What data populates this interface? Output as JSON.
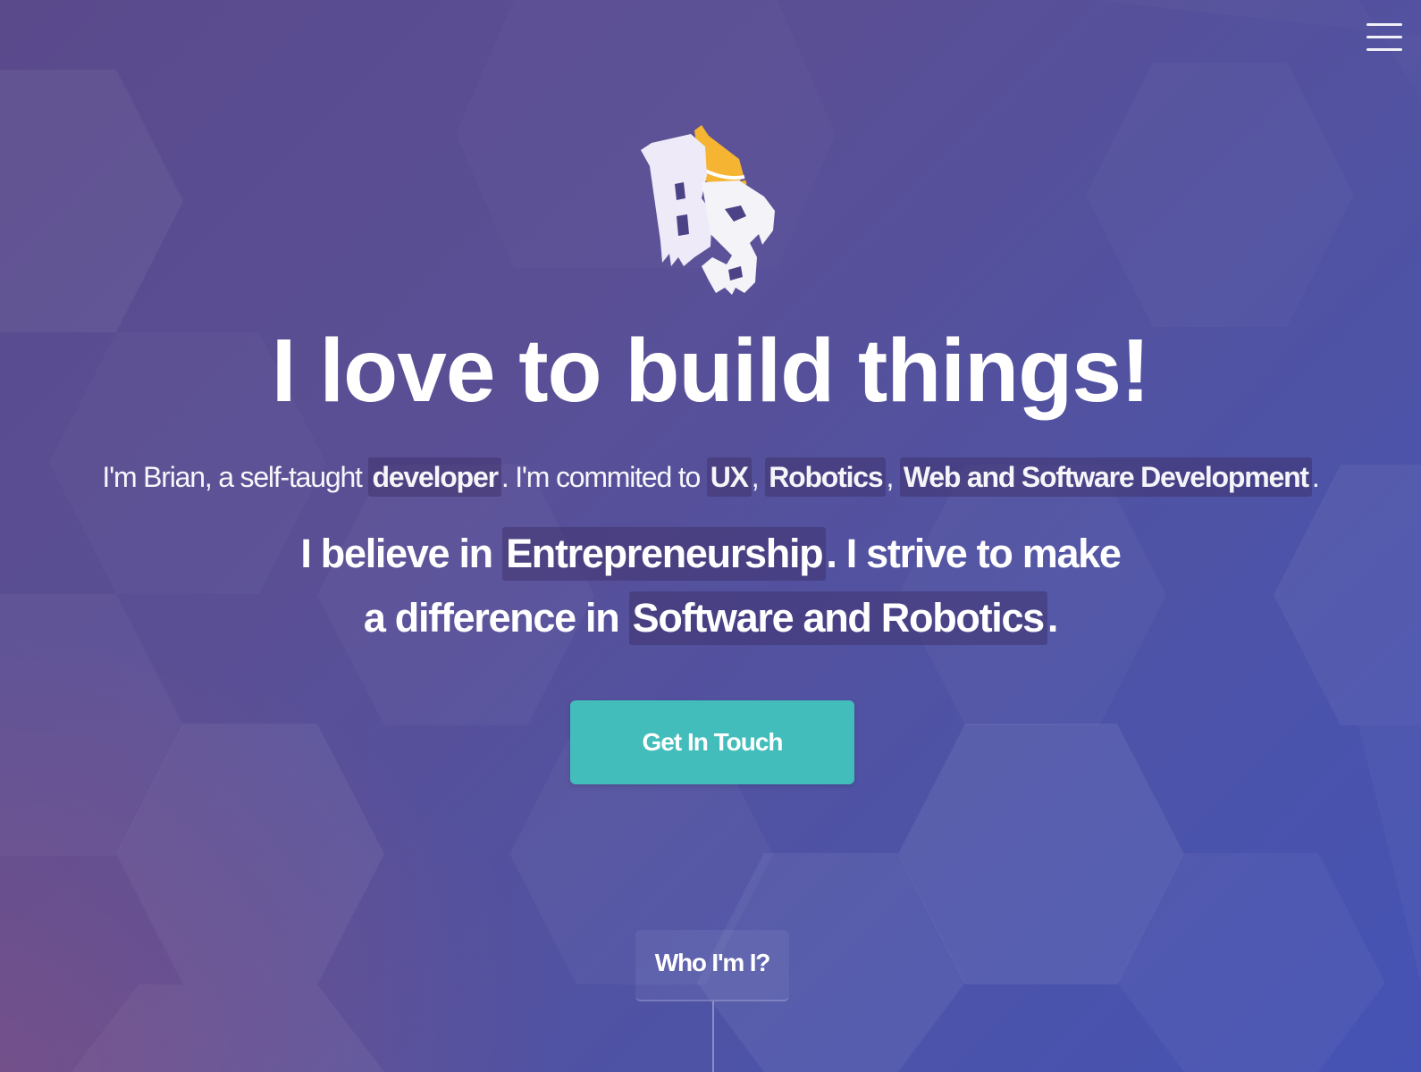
{
  "nav": {
    "menu_icon": "hamburger-menu-icon"
  },
  "logo": {
    "text": "BS",
    "icon": "bs-logo-hat-icon"
  },
  "hero": {
    "headline": "I love to build things!",
    "intro": {
      "prefix": "I'm Brian, a self-taught ",
      "role": "developer",
      "mid": ". I'm commited to ",
      "topic_1": "UX",
      "sep_1": ", ",
      "topic_2": "Robotics",
      "sep_2": ", ",
      "topic_3": "Web and Software Development",
      "suffix": "."
    },
    "belief": {
      "prefix": "I believe in ",
      "value_1": "Entrepreneurship",
      "mid": ". I strive to make",
      "line2_prefix": "a difference in ",
      "value_2": "Software and Robotics",
      "suffix": "."
    },
    "cta_label": "Get In Touch"
  },
  "scroll": {
    "label": "Who I'm I?"
  },
  "colors": {
    "cta": "#42bdbb",
    "background_start": "#5a4a8c",
    "background_end": "#4553b4",
    "logo_hat": "#f5b431",
    "logo_letters": "#eeeaf8"
  }
}
